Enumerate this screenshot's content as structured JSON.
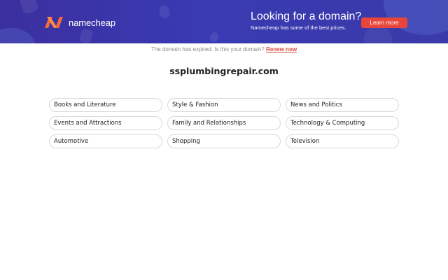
{
  "banner": {
    "logo_text": "namecheap",
    "promo_title": "Looking for a domain?",
    "promo_subtitle": "Namecheap has some of the best prices.",
    "learn_more_label": "Learn more",
    "colors": {
      "background": "#3a3ab3",
      "button": "#e9463b",
      "logo_accent": "#f26b3a"
    }
  },
  "notice": {
    "text": "The domain has expired. Is this your domain?",
    "renew_label": "Renew now"
  },
  "domain_name": "ssplumbingrepair.com",
  "categories": [
    "Books and Literature",
    "Style & Fashion",
    "News and Politics",
    "Events and Attractions",
    "Family and Relationships",
    "Technology & Computing",
    "Automotive",
    "Shopping",
    "Television"
  ]
}
